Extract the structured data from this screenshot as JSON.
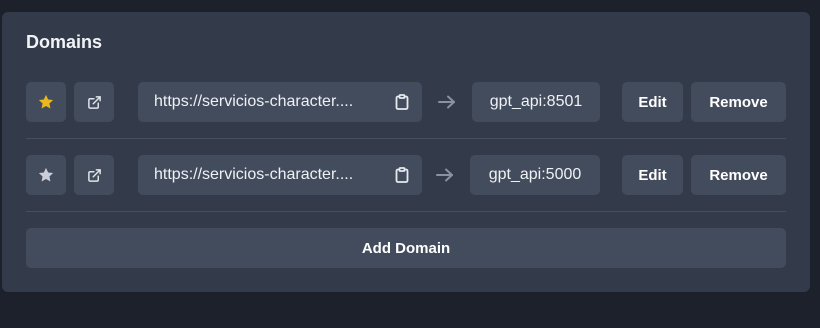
{
  "section": {
    "title": "Domains"
  },
  "domains": [
    {
      "favorite": true,
      "url": "https://servicios-character....",
      "target": "gpt_api:8501",
      "edit_label": "Edit",
      "remove_label": "Remove"
    },
    {
      "favorite": false,
      "url": "https://servicios-character....",
      "target": "gpt_api:5000",
      "edit_label": "Edit",
      "remove_label": "Remove"
    }
  ],
  "add_button_label": "Add Domain",
  "colors": {
    "star_active": "#e8b81c",
    "star_inactive": "#c9ced8",
    "card_bg": "#333b4a",
    "control_bg": "#434c5c",
    "page_bg": "#1c212c"
  },
  "icons": [
    "star-icon",
    "external-link-icon",
    "clipboard-icon",
    "arrow-right-icon"
  ]
}
